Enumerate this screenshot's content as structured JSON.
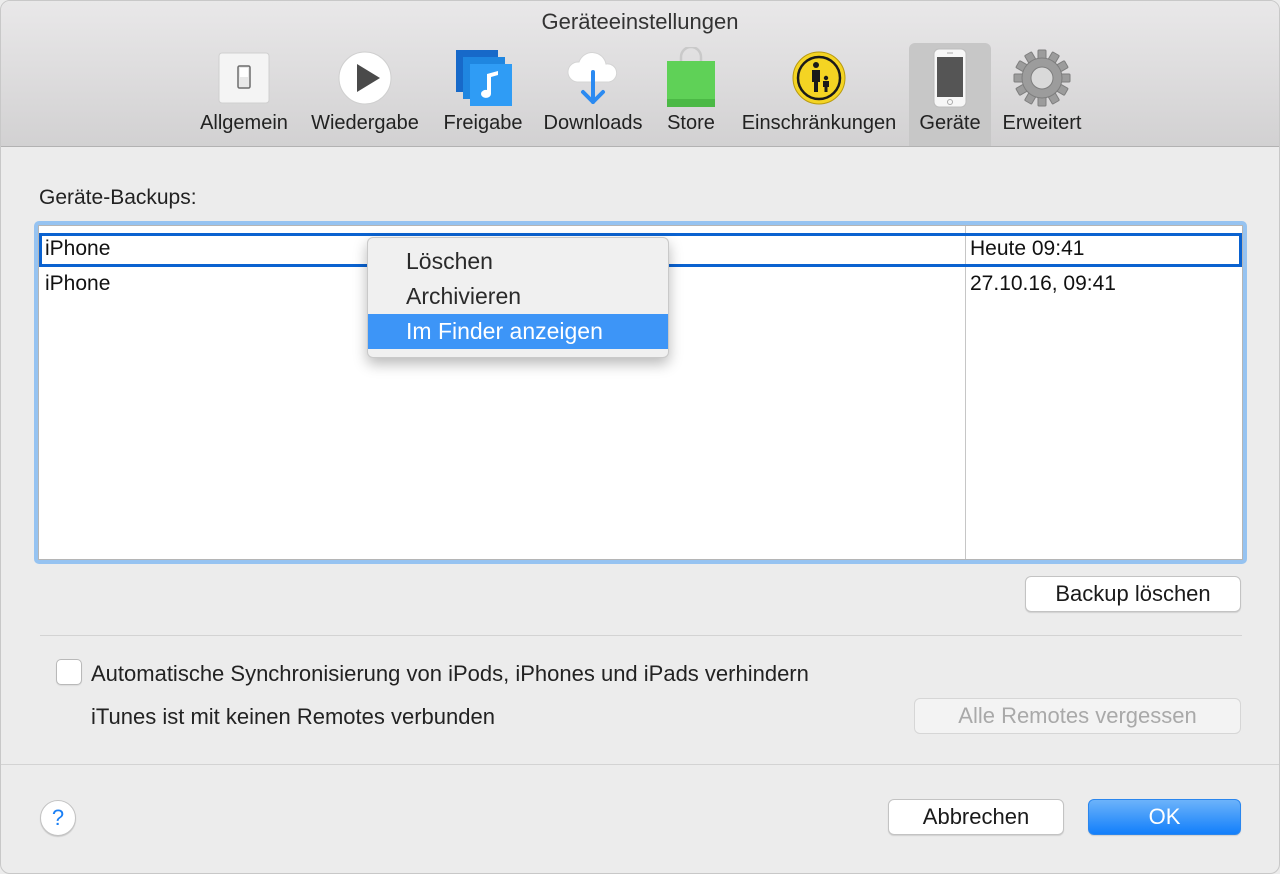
{
  "window": {
    "title": "Geräteeinstellungen"
  },
  "toolbar": {
    "items": [
      {
        "label": "Allgemein",
        "icon": "switch-icon",
        "selected": false
      },
      {
        "label": "Wiedergabe",
        "icon": "play-icon",
        "selected": false
      },
      {
        "label": "Freigabe",
        "icon": "shared-music-icon",
        "selected": false
      },
      {
        "label": "Downloads",
        "icon": "cloud-download-icon",
        "selected": false
      },
      {
        "label": "Store",
        "icon": "shopping-bag-icon",
        "selected": false
      },
      {
        "label": "Einschränkungen",
        "icon": "parental-controls-icon",
        "selected": false
      },
      {
        "label": "Geräte",
        "icon": "iphone-icon",
        "selected": true
      },
      {
        "label": "Erweitert",
        "icon": "gear-icon",
        "selected": false
      }
    ]
  },
  "backups": {
    "label": "Geräte-Backups:",
    "rows": [
      {
        "device": "iPhone",
        "date": "Heute 09:41",
        "selected": true
      },
      {
        "device": "iPhone",
        "date": "27.10.16, 09:41",
        "selected": false
      }
    ]
  },
  "context_menu": {
    "items": [
      {
        "label": "Löschen",
        "highlighted": false
      },
      {
        "label": "Archivieren",
        "highlighted": false
      },
      {
        "label": "Im Finder anzeigen",
        "highlighted": true
      }
    ]
  },
  "buttons": {
    "delete_backup": "Backup löschen",
    "forget_remotes": "Alle Remotes vergessen",
    "cancel": "Abbrechen",
    "ok": "OK",
    "help": "?"
  },
  "options": {
    "prevent_sync_label": "Automatische Synchronisierung von iPods, iPhones und iPads verhindern",
    "prevent_sync_checked": false,
    "remotes_status": "iTunes ist mit keinen Remotes verbunden"
  },
  "colors": {
    "accent": "#127ffb",
    "menu_highlight": "#3d95f7",
    "selection_border": "#0a62d0",
    "focus_ring": "#96c3f1"
  }
}
